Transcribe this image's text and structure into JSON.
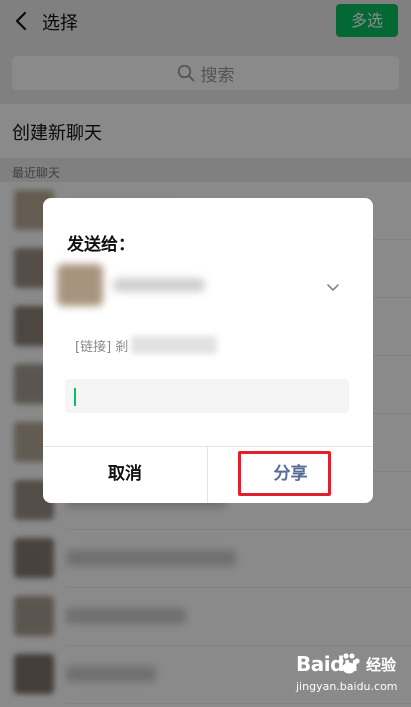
{
  "header": {
    "title": "选择",
    "multi_select_label": "多选"
  },
  "search": {
    "placeholder": "搜索"
  },
  "new_chat_label": "创建新聊天",
  "recent_label": "最近聊天",
  "dialog": {
    "title": "发送给：",
    "link_prefix": "[链接] 剎",
    "cancel_label": "取消",
    "share_label": "分享"
  },
  "watermark": {
    "brand": "Baidu",
    "brand_cn": "经验",
    "url": "jingyan.baidu.com"
  },
  "colors": {
    "accent_green": "#07c160",
    "share_blue": "#576b95",
    "highlight_red": "#e0202d"
  }
}
